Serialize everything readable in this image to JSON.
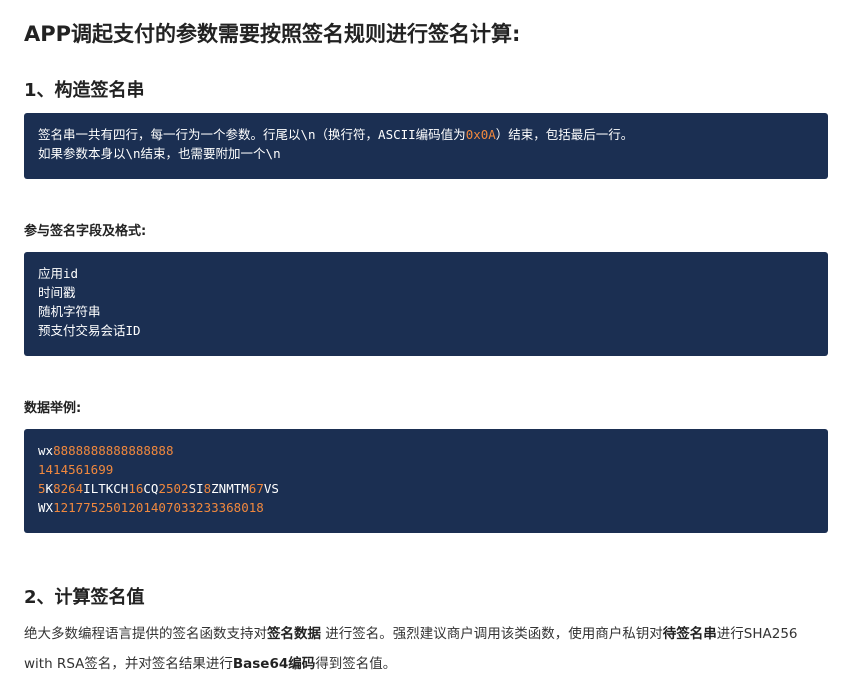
{
  "title": "APP调起支付的参数需要按照签名规则进行签名计算:",
  "section1": {
    "heading": "1、构造签名串",
    "intro_lines": [
      {
        "parts": [
          {
            "text": "签名串一共有四行，每一行为一个参数。行尾以\\n（换行符，ASCII编码值为",
            "hl": false
          },
          {
            "text": "0x0A",
            "hl": true
          },
          {
            "text": "）结束，包括最后一行。",
            "hl": false
          }
        ]
      },
      {
        "parts": [
          {
            "text": "如果参数本身以\\n结束，也需要附加一个\\n",
            "hl": false
          }
        ]
      }
    ],
    "fields_heading": "参与签名字段及格式:",
    "fields": [
      "应用id",
      "时间戳",
      "随机字符串",
      "预支付交易会话ID"
    ],
    "example_heading": "数据举例:",
    "example_lines": [
      {
        "parts": [
          {
            "text": "wx",
            "hl": false
          },
          {
            "text": "8888888888888888",
            "hl": true
          }
        ]
      },
      {
        "parts": [
          {
            "text": "1414561699",
            "hl": true
          }
        ]
      },
      {
        "parts": [
          {
            "text": "5",
            "hl": true
          },
          {
            "text": "K",
            "hl": false
          },
          {
            "text": "8264",
            "hl": true
          },
          {
            "text": "ILTKCH",
            "hl": false
          },
          {
            "text": "16",
            "hl": true
          },
          {
            "text": "CQ",
            "hl": false
          },
          {
            "text": "2502",
            "hl": true
          },
          {
            "text": "SI",
            "hl": false
          },
          {
            "text": "8",
            "hl": true
          },
          {
            "text": "ZNMTM",
            "hl": false
          },
          {
            "text": "67",
            "hl": true
          },
          {
            "text": "VS",
            "hl": false
          }
        ]
      },
      {
        "parts": [
          {
            "text": "WX",
            "hl": false
          },
          {
            "text": "121775250120140703323336801",
            "hl": true
          },
          {
            "text": "8",
            "hl": true
          }
        ]
      }
    ]
  },
  "section2": {
    "heading": "2、计算签名值",
    "paragraph": [
      {
        "text": "绝大多数编程语言提供的签名函数支持对",
        "bold": false
      },
      {
        "text": "签名数据",
        "bold": true
      },
      {
        "text": " 进行签名。强烈建议商户调用该类函数，使用商户私钥对",
        "bold": false
      },
      {
        "text": "待签名串",
        "bold": true
      },
      {
        "text": "进行SHA256 with RSA签名，并对签名结果进行",
        "bold": false
      },
      {
        "text": "Base64编码",
        "bold": true
      },
      {
        "text": "得到签名值。",
        "bold": false
      }
    ]
  },
  "colors": {
    "code_bg": "#1b2f52",
    "highlight": "#f0883e",
    "text": "#222222"
  }
}
